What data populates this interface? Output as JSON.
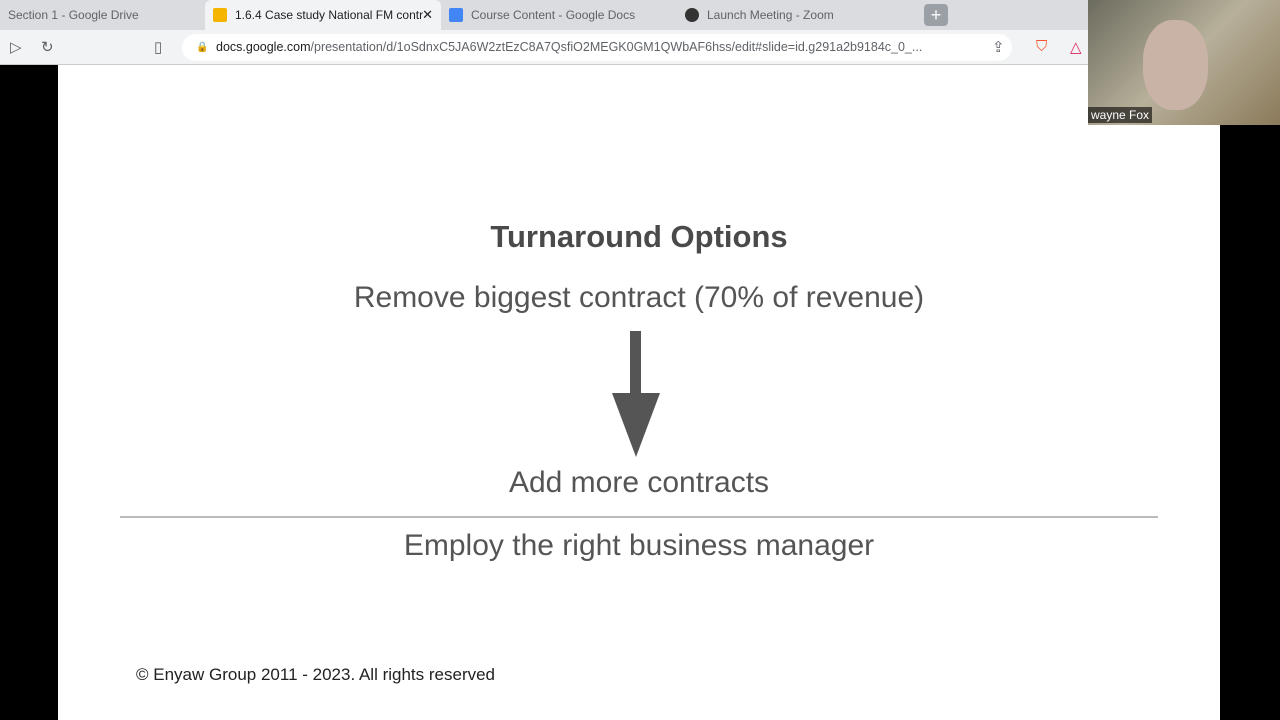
{
  "browser": {
    "tabs": [
      {
        "label": "Section 1 - Google Drive",
        "active": false
      },
      {
        "label": "1.6.4 Case study National FM contr",
        "active": true,
        "icon": "slides-icon"
      },
      {
        "label": "Course Content - Google Docs",
        "active": false,
        "icon": "docs-icon"
      },
      {
        "label": "Launch Meeting - Zoom",
        "active": false,
        "icon": "globe-icon"
      }
    ],
    "new_tab": "+",
    "close": "✕",
    "url_host": "docs.google.com",
    "url_path": "/presentation/d/1oSdnxC5JA6W2ztEzC8A7QsfiO2MEGK0GM1QWbAF6hss/edit#slide=id.g291a2b9184c_0_..."
  },
  "slide": {
    "title": "Turnaround Options",
    "line1": "Remove biggest contract  (70% of revenue)",
    "line2": "Add more contracts",
    "line3": "Employ the right business manager",
    "copyright": "© Enyaw Group 2011 - 2023.  All rights reserved"
  },
  "video": {
    "name": "wayne Fox"
  }
}
